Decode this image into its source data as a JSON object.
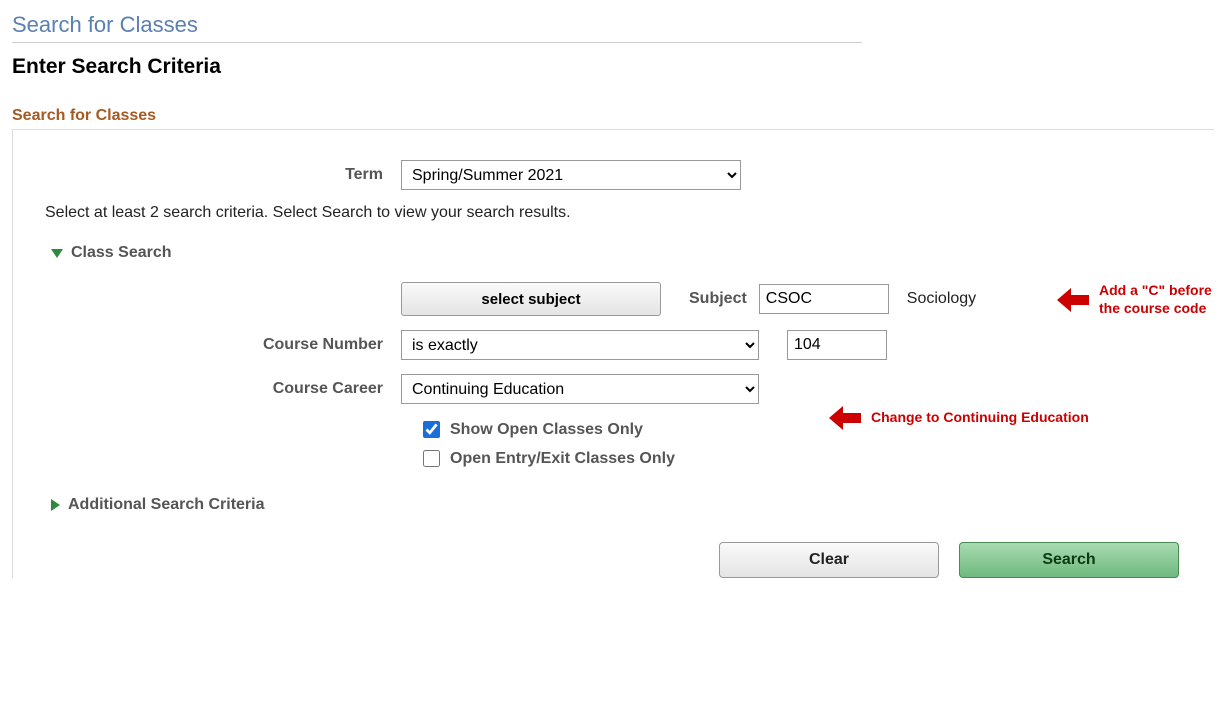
{
  "header": {
    "page_title": "Search for Classes",
    "subtitle": "Enter Search Criteria",
    "section_label": "Search for Classes"
  },
  "form": {
    "term_label": "Term",
    "term_value": "Spring/Summer 2021",
    "instructions": "Select at least 2 search criteria. Select Search to view your search results.",
    "class_search_label": "Class Search",
    "select_subject_btn": "select subject",
    "subject_label": "Subject",
    "subject_value": "CSOC",
    "subject_display": "Sociology",
    "course_number_label": "Course Number",
    "course_number_op": "is exactly",
    "course_number_value": "104",
    "course_career_label": "Course Career",
    "course_career_value": "Continuing Education",
    "show_open_label": "Show Open Classes Only",
    "show_open_checked": true,
    "open_entry_label": "Open Entry/Exit Classes Only",
    "open_entry_checked": false,
    "additional_label": "Additional Search Criteria"
  },
  "buttons": {
    "clear": "Clear",
    "search": "Search"
  },
  "annotations": {
    "add_c": "Add a \"C\" before the course code",
    "change_ce": "Change to Continuing Education"
  }
}
